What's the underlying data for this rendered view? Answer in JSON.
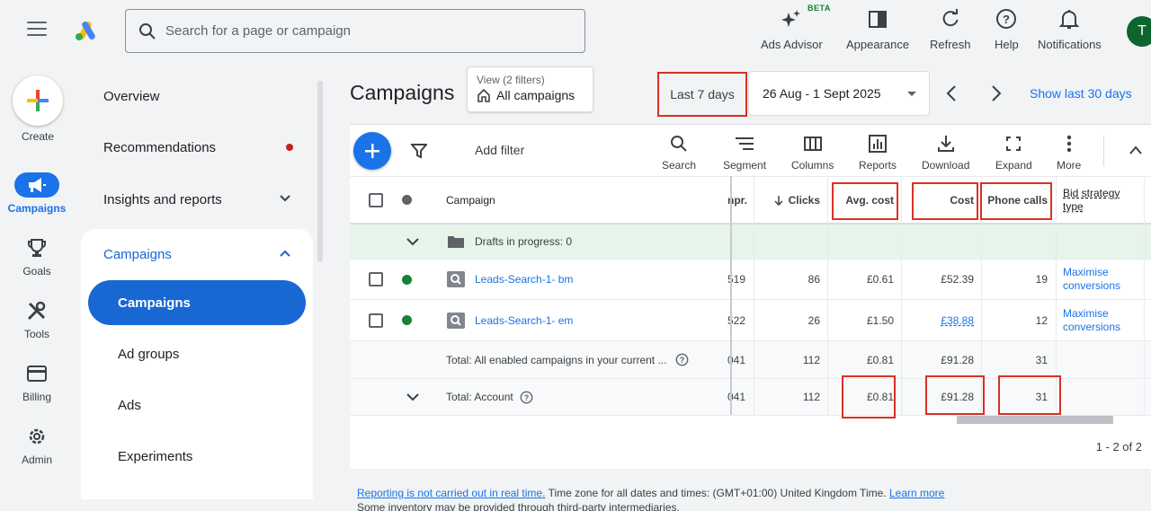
{
  "header": {
    "search_placeholder": "Search for a page or campaign",
    "beta_label": "BETA",
    "tools": [
      {
        "label": "Ads Advisor",
        "icon": "sparkle-icon"
      },
      {
        "label": "Appearance",
        "icon": "appearance-icon"
      },
      {
        "label": "Refresh",
        "icon": "refresh-icon"
      },
      {
        "label": "Help",
        "icon": "help-icon"
      },
      {
        "label": "Notifications",
        "icon": "bell-icon"
      }
    ],
    "avatar_initial": "T"
  },
  "rail": {
    "create_label": "Create",
    "items": [
      {
        "label": "Campaigns",
        "icon": "megaphone-icon",
        "active": true
      },
      {
        "label": "Goals",
        "icon": "trophy-icon"
      },
      {
        "label": "Tools",
        "icon": "tools-icon"
      },
      {
        "label": "Billing",
        "icon": "card-icon"
      },
      {
        "label": "Admin",
        "icon": "gear-icon"
      }
    ]
  },
  "sidenav": {
    "items": [
      {
        "label": "Overview"
      },
      {
        "label": "Recommendations"
      },
      {
        "label": "Insights and reports"
      },
      {
        "label": "Campaigns"
      }
    ],
    "children": [
      {
        "label": "Campaigns",
        "active": true
      },
      {
        "label": "Ad groups"
      },
      {
        "label": "Ads"
      },
      {
        "label": "Experiments"
      }
    ]
  },
  "main": {
    "title": "Campaigns",
    "view_filters": "View (2 filters)",
    "view_name": "All campaigns",
    "date_preset": "Last 7 days",
    "date_range": "26 Aug - 1 Sept 2025",
    "show_last": "Show last 30 days"
  },
  "toolbar": {
    "add_filter": "Add filter",
    "tools": [
      {
        "label": "Search",
        "icon": "search-icon"
      },
      {
        "label": "Segment",
        "icon": "segment-icon"
      },
      {
        "label": "Columns",
        "icon": "columns-icon"
      },
      {
        "label": "Reports",
        "icon": "reports-icon"
      },
      {
        "label": "Download",
        "icon": "download-icon"
      },
      {
        "label": "Expand",
        "icon": "expand-icon"
      },
      {
        "label": "More",
        "icon": "more-vert-icon"
      }
    ]
  },
  "table": {
    "headers": {
      "campaign": "Campaign",
      "impr": "npr.",
      "clicks": "Clicks",
      "avg_cost": "Avg. cost",
      "cost": "Cost",
      "phone_calls": "Phone calls",
      "bid_strategy_line1": "Bid strategy",
      "bid_strategy_line2": "type"
    },
    "drafts": "Drafts in progress: 0",
    "rows": [
      {
        "campaign": "Leads-Search-1- bm",
        "impr": "519",
        "clicks": "86",
        "avg_cost": "£0.61",
        "cost": "£52.39",
        "phone_calls": "19",
        "bid_line1": "Maximise",
        "bid_line2": "conversions"
      },
      {
        "campaign": "Leads-Search-1- em",
        "impr": "522",
        "clicks": "26",
        "avg_cost": "£1.50",
        "cost": "£38.88",
        "phone_calls": "12",
        "bid_line1": "Maximise",
        "bid_line2": "conversions"
      }
    ],
    "total_enabled": {
      "label": "Total: All enabled campaigns in your current ...",
      "impr": "041",
      "clicks": "112",
      "avg_cost": "£0.81",
      "cost": "£91.28",
      "phone_calls": "31"
    },
    "total_account": {
      "label": "Total: Account",
      "impr": "041",
      "clicks": "112",
      "avg_cost": "£0.81",
      "cost": "£91.28",
      "phone_calls": "31"
    },
    "pager": "1 - 2 of 2"
  },
  "footer": {
    "realtime_link": "Reporting is not carried out in real time.",
    "timezone": "Time zone for all dates and times: (GMT+01:00) United Kingdom Time.",
    "learn_more": "Learn more",
    "inventory": "Some inventory may be provided through third-party intermediaries."
  },
  "colors": {
    "accent": "#1a73e8",
    "enabled": "#188038",
    "highlight": "#d93025"
  }
}
